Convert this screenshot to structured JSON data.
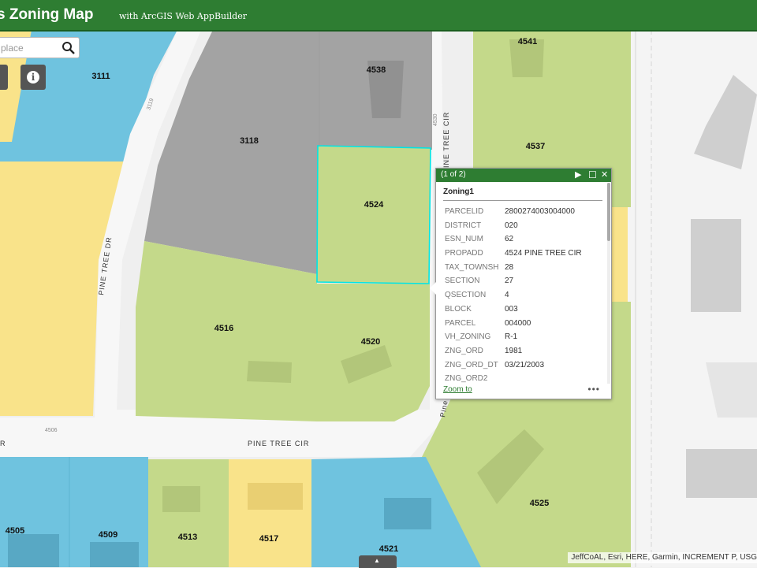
{
  "header": {
    "app_title": "s Zoning Map",
    "subtitle": "with ArcGIS Web AppBuilder"
  },
  "search": {
    "placeholder": "place",
    "icon": "search-icon"
  },
  "toolbar": {
    "info_icon": "info-icon",
    "info_glyph": "i"
  },
  "colors": {
    "header_green": "#2e7d32",
    "residential_green": "#c4d98a",
    "commercial_gray": "#a3a3a3",
    "yellow_zone": "#f9e38a",
    "blue_zone": "#6fc3df",
    "selection_cyan": "#00e5e5"
  },
  "map": {
    "parcel_labels": [
      "3111",
      "4538",
      "4541",
      "3118",
      "4537",
      "4524",
      "4516",
      "4520",
      "4525",
      "4505",
      "4509",
      "4513",
      "4517",
      "4521"
    ],
    "street_labels": [
      "PINE TREE CIR",
      "PINE TREE DR",
      "PINE TREE CIR",
      "R",
      "Pine"
    ],
    "small_labels": [
      "3119",
      "4530",
      "4506"
    ]
  },
  "popup": {
    "count": "(1 of 2)",
    "controls": {
      "next": "▶",
      "maximize": "☐",
      "close": "✕"
    },
    "title": "Zoning1",
    "rows": [
      {
        "key": "PARCELID",
        "value": "2800274003004000"
      },
      {
        "key": "DISTRICT",
        "value": "020"
      },
      {
        "key": "ESN_NUM",
        "value": "62"
      },
      {
        "key": "PROPADD",
        "value": "4524 PINE TREE CIR"
      },
      {
        "key": "TAX_TOWNSH",
        "value": "28"
      },
      {
        "key": "SECTION",
        "value": "27"
      },
      {
        "key": "QSECTION",
        "value": "4"
      },
      {
        "key": "BLOCK",
        "value": "003"
      },
      {
        "key": "PARCEL",
        "value": "004000"
      },
      {
        "key": "VH_ZONING",
        "value": "R-1"
      },
      {
        "key": "ZNG_ORD",
        "value": "1981"
      },
      {
        "key": "ZNG_ORD_DT",
        "value": "03/21/2003"
      },
      {
        "key": "ZNG_ORD2",
        "value": ""
      }
    ],
    "zoom_link": "Zoom to",
    "more": "•••"
  },
  "attribution": "JeffCoAL, Esri, HERE, Garmin, INCREMENT P, USG",
  "expand": {
    "glyph": "▲"
  }
}
